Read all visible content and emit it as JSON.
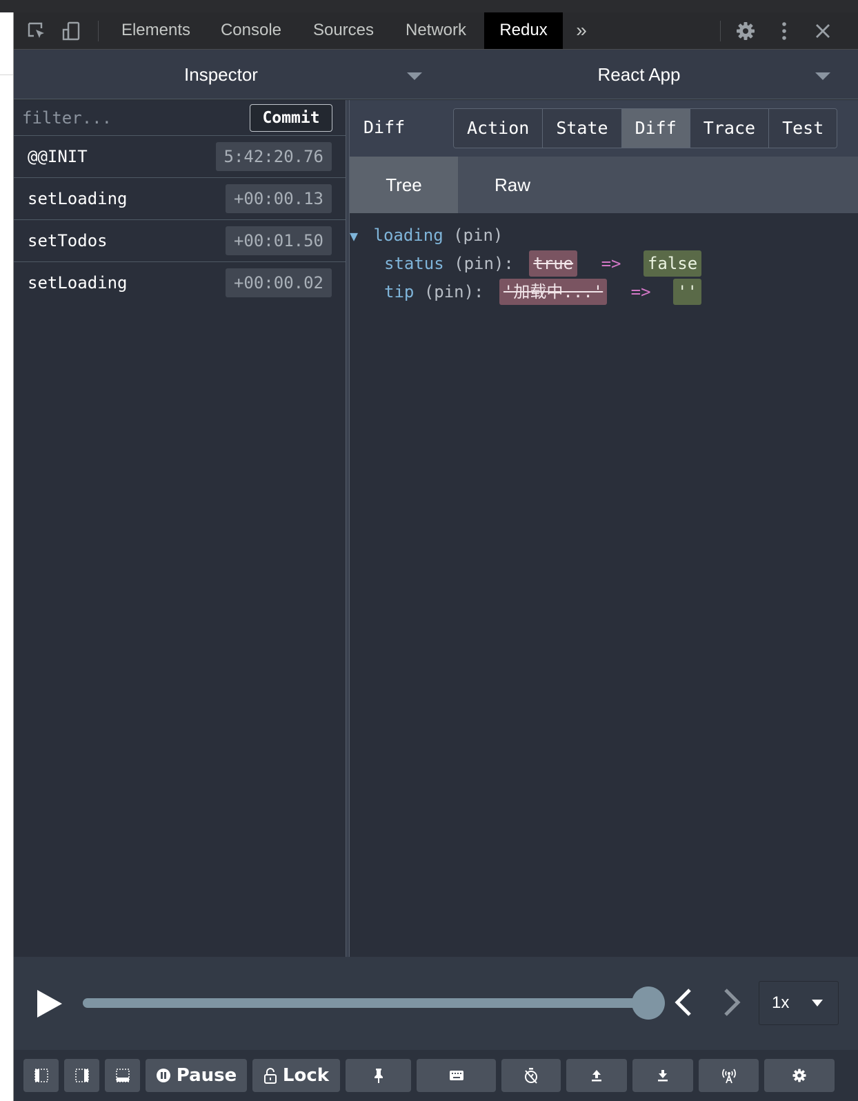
{
  "devtools": {
    "tabs": [
      {
        "label": "Elements"
      },
      {
        "label": "Console"
      },
      {
        "label": "Sources"
      },
      {
        "label": "Network"
      },
      {
        "label": "Redux",
        "active": true
      }
    ],
    "more_tabs_glyph": "»"
  },
  "selectors": {
    "monitor": "Inspector",
    "instance": "React App"
  },
  "actions": {
    "filter_placeholder": "filter...",
    "commit_label": "Commit",
    "items": [
      {
        "name": "@@INIT",
        "time": "5:42:20.76"
      },
      {
        "name": "setLoading",
        "time": "+00:00.13"
      },
      {
        "name": "setTodos",
        "time": "+00:01.50"
      },
      {
        "name": "setLoading",
        "time": "+00:00.02"
      }
    ]
  },
  "inspector": {
    "label": "Diff",
    "tabs": [
      "Action",
      "State",
      "Diff",
      "Trace",
      "Test"
    ],
    "active_tab": "Diff",
    "views": [
      "Tree",
      "Raw"
    ],
    "active_view": "Tree",
    "tree": {
      "root": {
        "key": "loading",
        "pin": "(pin)",
        "arrow": "▼"
      },
      "rows": [
        {
          "key": "status",
          "pin": "(pin):",
          "old": "true",
          "op": "=>",
          "new": "false"
        },
        {
          "key": "tip",
          "pin": "(pin):",
          "old": "'加载中...'",
          "op": "=>",
          "new": "''"
        }
      ]
    }
  },
  "slider": {
    "position": 1.0,
    "speed": "1x"
  },
  "toolbar": {
    "pause_label": "Pause",
    "lock_label": "Lock"
  },
  "colors": {
    "panel_bg": "#2a2f3a",
    "diff_removed": "#7a5461",
    "diff_added": "#5a6a48",
    "tree_key": "#7fb5da",
    "arrow_op": "#d277c6"
  }
}
